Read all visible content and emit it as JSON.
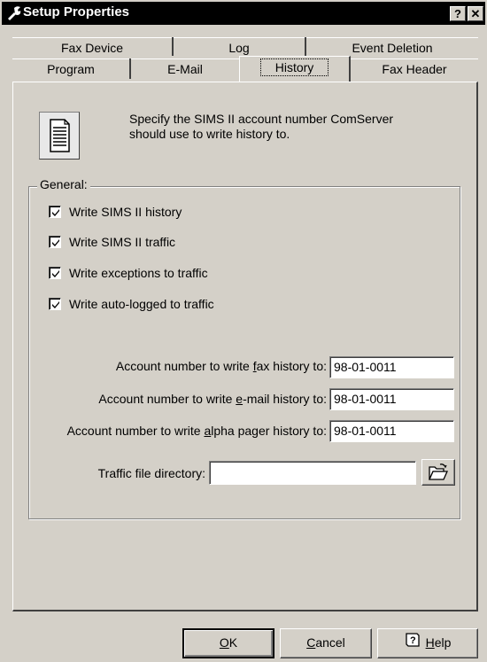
{
  "window": {
    "title": "Setup Properties"
  },
  "titlebar": {
    "help_label": "?",
    "close_label": "✕"
  },
  "tabs": {
    "row1": [
      "Fax Device",
      "Log",
      "Event Deletion"
    ],
    "row2": [
      "Program",
      "E-Mail",
      "History",
      "Fax Header"
    ],
    "active": "History"
  },
  "description": {
    "line1": "Specify the SIMS II account number ComServer",
    "line2": "should use to write history to."
  },
  "general": {
    "label": "General:",
    "checkboxes": [
      {
        "label": "Write SIMS II history",
        "checked": true
      },
      {
        "label": "Write SIMS II traffic",
        "checked": true
      },
      {
        "label": "Write exceptions to traffic",
        "checked": true
      },
      {
        "label": "Write auto-logged to traffic",
        "checked": true
      }
    ]
  },
  "accounts": {
    "fax": {
      "label_pre": "Account number to write ",
      "label_key": "f",
      "label_post": "ax history to:",
      "value": "98-01-0011"
    },
    "email": {
      "label_pre": "Account number to write ",
      "label_key": "e",
      "label_post": "-mail history to:",
      "value": "98-01-0011"
    },
    "pager": {
      "label_pre": "Account number to write ",
      "label_key": "a",
      "label_post": "lpha pager history to:",
      "value": "98-01-0011"
    }
  },
  "traffic": {
    "label": "Traffic file directory:",
    "value": ""
  },
  "buttons": {
    "ok": {
      "key": "O",
      "rest": "K"
    },
    "cancel": {
      "key": "C",
      "rest": "ancel"
    },
    "help": {
      "key": "H",
      "rest": "elp"
    }
  },
  "icons": [
    "wrench-icon",
    "document-icon",
    "folder-open-icon",
    "help-book-icon",
    "check-icon"
  ]
}
